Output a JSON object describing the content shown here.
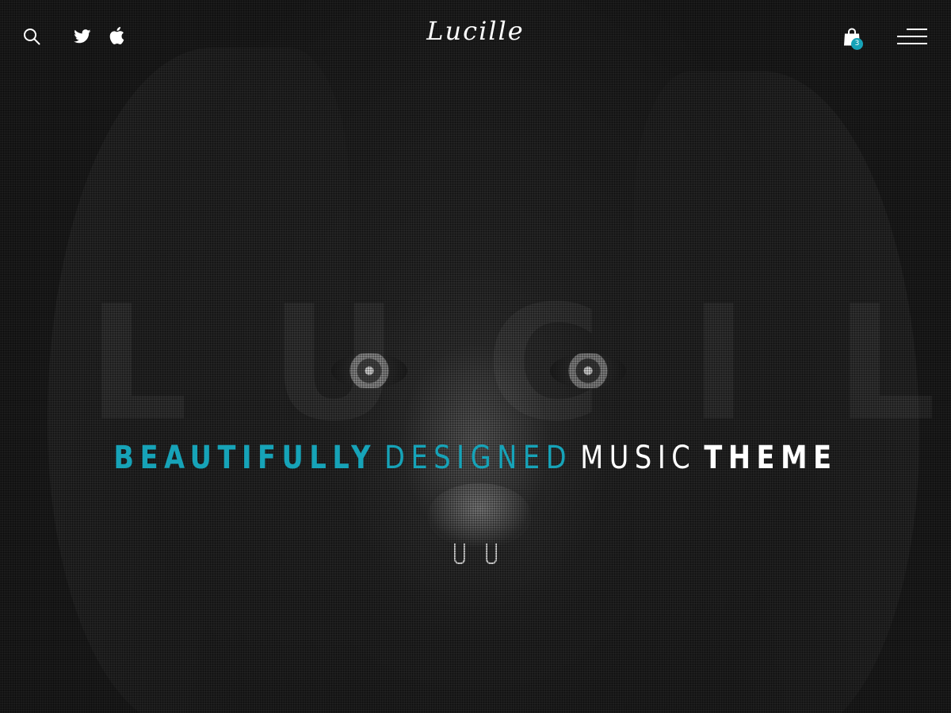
{
  "header": {
    "logo_text": "Lucille",
    "left_icons": [
      "search-icon",
      "twitter-icon",
      "apple-icon"
    ],
    "right_icons": [
      "shopping-bag-icon",
      "hamburger-menu-icon"
    ],
    "cart_count": "3"
  },
  "hero": {
    "watermark_text": "LUCILLE",
    "tagline": {
      "part1": "BEAUTIFULLY",
      "part2": "DESIGNED",
      "part3": "MUSIC",
      "part4": "THEME"
    }
  },
  "colors": {
    "accent": "#16a3b8",
    "background": "#1b1b1b",
    "text": "#ffffff"
  }
}
